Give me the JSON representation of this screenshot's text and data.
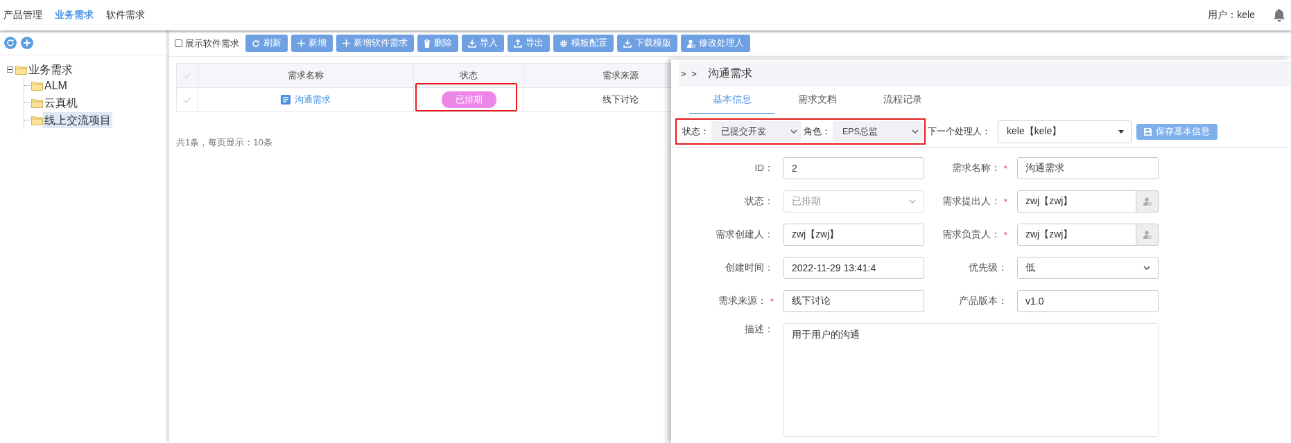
{
  "nav": {
    "items": [
      {
        "label": "产品管理",
        "selected": false
      },
      {
        "label": "业务需求",
        "selected": true
      },
      {
        "label": "软件需求",
        "selected": false
      }
    ],
    "user": "用户：kele"
  },
  "sidebar": {
    "tree": [
      {
        "label": "业务需求",
        "expanded": true,
        "selected": false,
        "children": [
          {
            "label": "ALM",
            "selected": false
          },
          {
            "label": "云真机",
            "selected": false
          },
          {
            "label": "线上交流项目",
            "selected": true
          }
        ]
      }
    ]
  },
  "toolbar": {
    "show_software": {
      "label": "展示软件需求",
      "checked": false
    },
    "buttons": [
      {
        "label": "刷新",
        "kind": "refresh"
      },
      {
        "label": "新增",
        "kind": "add"
      },
      {
        "label": "新增软件需求",
        "kind": "add"
      },
      {
        "label": "删除",
        "kind": "delete"
      },
      {
        "label": "导入",
        "kind": "import"
      },
      {
        "label": "导出",
        "kind": "export"
      },
      {
        "label": "模板配置",
        "kind": "settings"
      },
      {
        "label": "下载模版",
        "kind": "download"
      },
      {
        "label": "修改处理人",
        "kind": "user"
      }
    ]
  },
  "table": {
    "columns": [
      "需求名称",
      "状态",
      "需求来源"
    ],
    "rows": [
      {
        "name": "沟通需求",
        "status": "已排期",
        "source": "线下讨论",
        "highlighted": true
      }
    ]
  },
  "pager": "共1条，每页显示：10条",
  "panel": {
    "prefix": "> >",
    "title": "沟通需求",
    "tabs": [
      {
        "label": "基本信息",
        "selected": true
      },
      {
        "label": "需求文档",
        "selected": false
      },
      {
        "label": "流程记录",
        "selected": false
      }
    ],
    "action_bar": {
      "highlighted": true,
      "status_label": "状态：",
      "status_value": "已提交开发",
      "role_label": "角色：",
      "role_value": "EPS总监",
      "handler_label": "下一个处理人：",
      "handler_value": "kele【kele】",
      "save": "保存基本信息"
    },
    "fields": [
      {
        "label": "ID：",
        "value": "2",
        "kind": "text",
        "disabled": false
      },
      {
        "label": "需求名称：",
        "mark": "*",
        "value": "沟通需求",
        "kind": "text",
        "disabled": false
      },
      {
        "label": "状态：",
        "value": "已排期",
        "kind": "select",
        "disabled": true
      },
      {
        "label": "需求提出人：",
        "mark": "*",
        "value": "zwj【zwj】",
        "kind": "picker",
        "disabled": false
      },
      {
        "label": "需求创建人：",
        "value": "zwj【zwj】",
        "kind": "text",
        "disabled": false
      },
      {
        "label": "需求负责人：",
        "mark": "*",
        "value": "zwj【zwj】",
        "kind": "picker",
        "disabled": false
      },
      {
        "label": "创建时间：",
        "value": "2022-11-29 13:41:4",
        "kind": "text",
        "disabled": false
      },
      {
        "label": "优先级：",
        "value": "低",
        "kind": "select",
        "disabled": false
      },
      {
        "label": "需求来源：",
        "mark": "*",
        "value": "线下讨论",
        "kind": "text",
        "disabled": false
      },
      {
        "label": "产品版本：",
        "value": "v1.0",
        "kind": "text",
        "disabled": false
      },
      {
        "label": "描述：",
        "value": "用于用户的沟通",
        "kind": "textarea",
        "disabled": false
      }
    ]
  }
}
